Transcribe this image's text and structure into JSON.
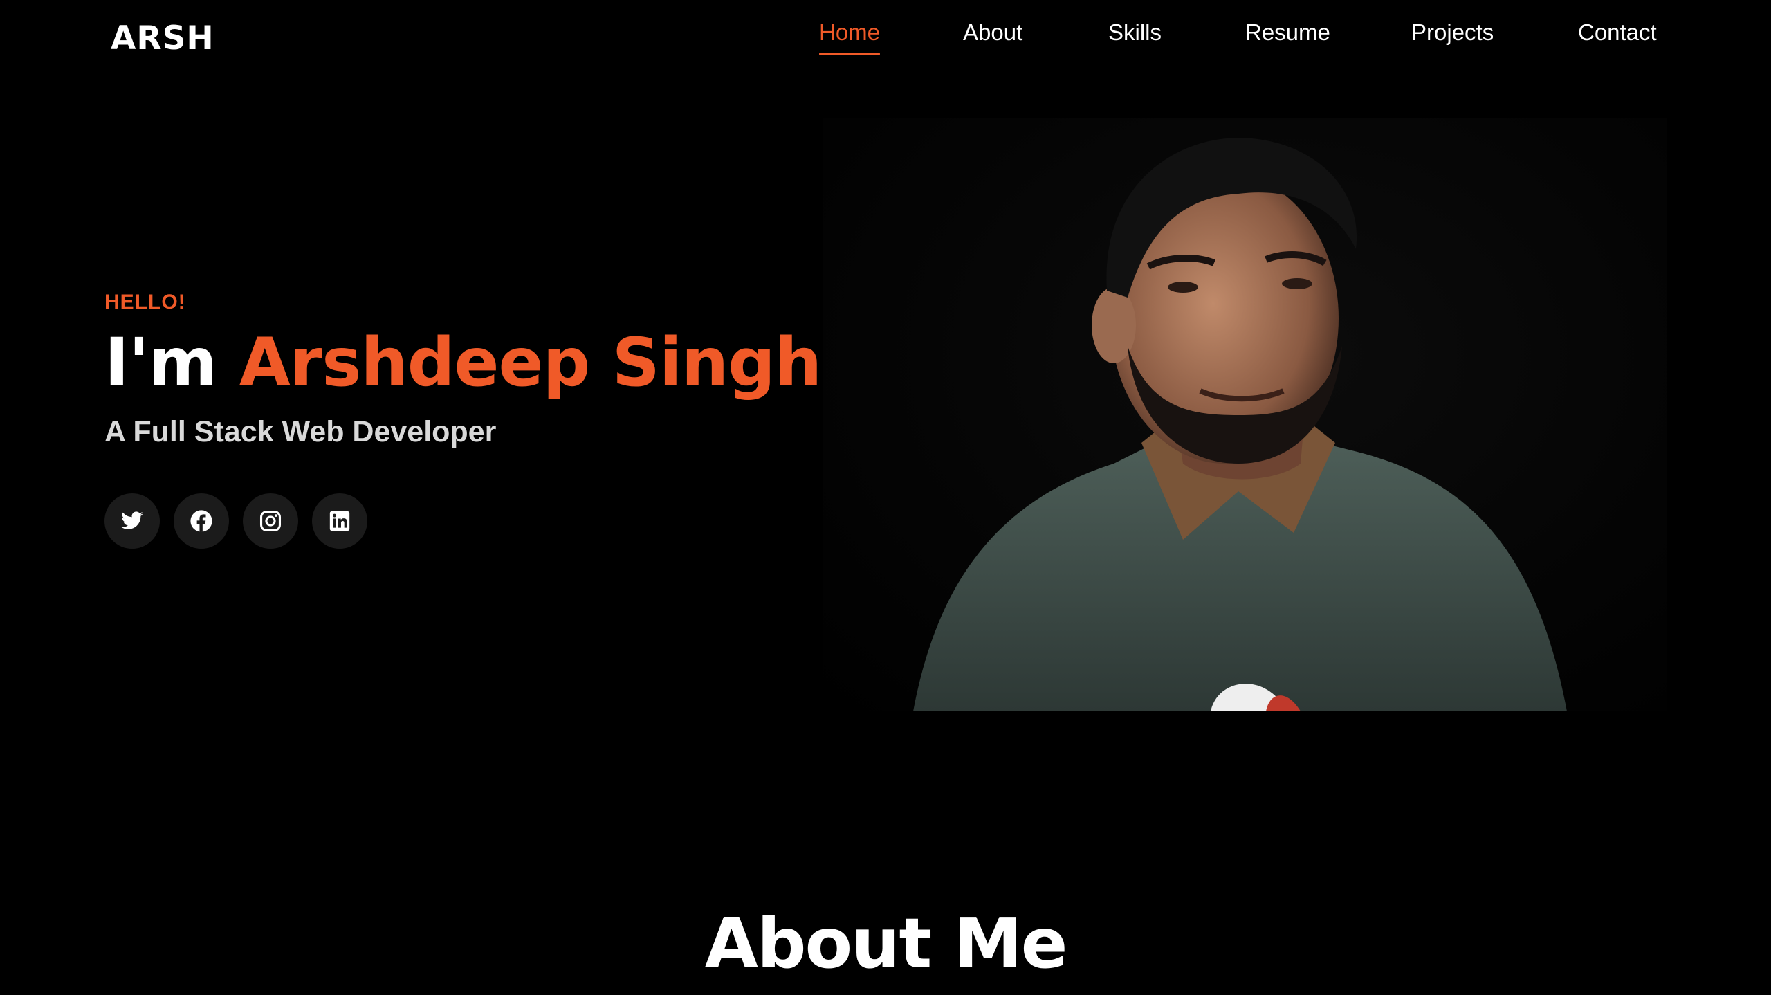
{
  "header": {
    "logo": "ARSH",
    "nav": [
      {
        "label": "Home",
        "active": true
      },
      {
        "label": "About",
        "active": false
      },
      {
        "label": "Skills",
        "active": false
      },
      {
        "label": "Resume",
        "active": false
      },
      {
        "label": "Projects",
        "active": false
      },
      {
        "label": "Contact",
        "active": false
      }
    ]
  },
  "hero": {
    "greeting": "HELLO!",
    "headline_lead": "I'm",
    "headline_name": "Arshdeep Singh",
    "subtitle": "A Full Stack Web Developer",
    "socials": [
      {
        "icon": "twitter-icon"
      },
      {
        "icon": "facebook-icon"
      },
      {
        "icon": "instagram-icon"
      },
      {
        "icon": "linkedin-icon"
      }
    ],
    "portrait_icon": "profile-photo"
  },
  "about": {
    "title": "About Me"
  },
  "colors": {
    "accent": "#f05a28",
    "background": "#000000",
    "social_bg": "#1b1b1b",
    "subtitle": "#d9d9d9"
  }
}
